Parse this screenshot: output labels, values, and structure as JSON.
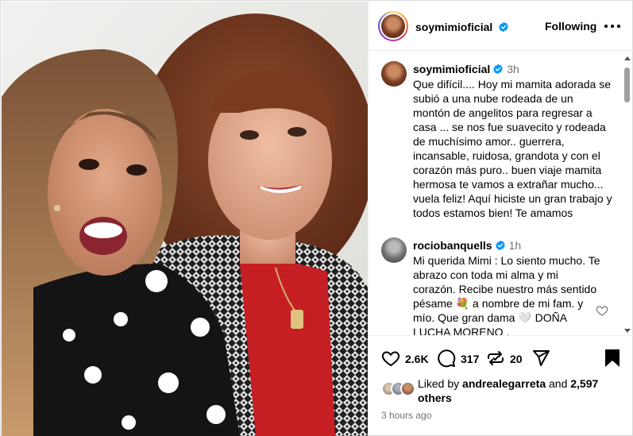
{
  "post": {
    "username": "soymimioficial",
    "follow_label": "Following",
    "more_label": "•••"
  },
  "caption": {
    "username": "soymimioficial",
    "time": "3h",
    "text": "Que difícil.... Hoy mi mamita adorada se subió a una nube rodeada de un montón de angelitos para regresar a casa ... se nos fue suavecito y rodeada de muchísimo amor.. guerrera, incansable, ruidosa, grandota y con el corazón más puro.. buen viaje mamita hermosa te vamos a extrañar mucho... vuela feliz! Aquí hiciste un gran trabajo y todos estamos bien! Te amamos"
  },
  "comments": [
    {
      "username": "rociobanquells",
      "time": "1h",
      "text": "Mi querida Mimi : Lo siento mucho. Te abrazo con toda mi alma y mi corazón. Recibe nuestro más sentido pésame 💐 a nombre de mi fam. y mío. Que gran dama 🤍 DOÑA LUCHA MORENO ,"
    }
  ],
  "actions": {
    "likes_count": "2.6K",
    "comments_count": "317",
    "reposts_count": "20"
  },
  "likes": {
    "prefix": "Liked by",
    "user": "andrealegarreta",
    "joiner": "and",
    "others": "2,597 others"
  },
  "timestamp": "3 hours ago",
  "icons": {
    "verified": "verified-badge-icon",
    "like": "heart-icon",
    "comment": "speech-bubble-icon",
    "repost": "repost-icon",
    "share": "paper-plane-icon",
    "save": "bookmark-icon"
  },
  "colors": {
    "verified_blue": "#0095f6",
    "muted_text": "#737373",
    "divider": "#efefef"
  }
}
